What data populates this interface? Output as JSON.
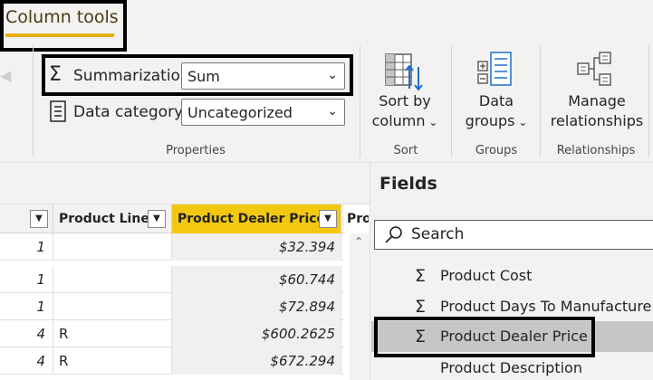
{
  "ribbon": {
    "tab_label": "Column tools",
    "summarization_label": "Summarization",
    "summarization_value": "Sum",
    "data_category_label": "Data category",
    "data_category_value": "Uncategorized",
    "properties_group": "Properties",
    "sort_by_label_1": "Sort by",
    "sort_by_label_2": "column",
    "sort_group": "Sort",
    "data_groups_label_1": "Data",
    "data_groups_label_2": "groups",
    "groups_group": "Groups",
    "manage_label_1": "Manage",
    "manage_label_2": "relationships",
    "relationships_group": "Relationships",
    "accent_color": "#e8b100"
  },
  "grid": {
    "headers": {
      "product_line": "Product Line",
      "dealer_price": "Product Dealer Price",
      "next_col": "Pro"
    },
    "rows": [
      {
        "count": "1",
        "line": "",
        "price": "$32.394"
      },
      {
        "count": "1",
        "line": "",
        "price": "$60.744"
      },
      {
        "count": "1",
        "line": "",
        "price": "$72.894"
      },
      {
        "count": "4",
        "line": "R",
        "price": "$600.2625"
      },
      {
        "count": "4",
        "line": "R",
        "price": "$672.294"
      }
    ]
  },
  "fields": {
    "title": "Fields",
    "search_placeholder": "Search",
    "items": [
      {
        "icon": "sigma-icon",
        "label": "Product Cost"
      },
      {
        "icon": "sigma-icon",
        "label": "Product Days To Manufacture"
      },
      {
        "icon": "sigma-icon",
        "label": "Product Dealer Price"
      },
      {
        "icon": "",
        "label": "Product Description"
      }
    ]
  }
}
